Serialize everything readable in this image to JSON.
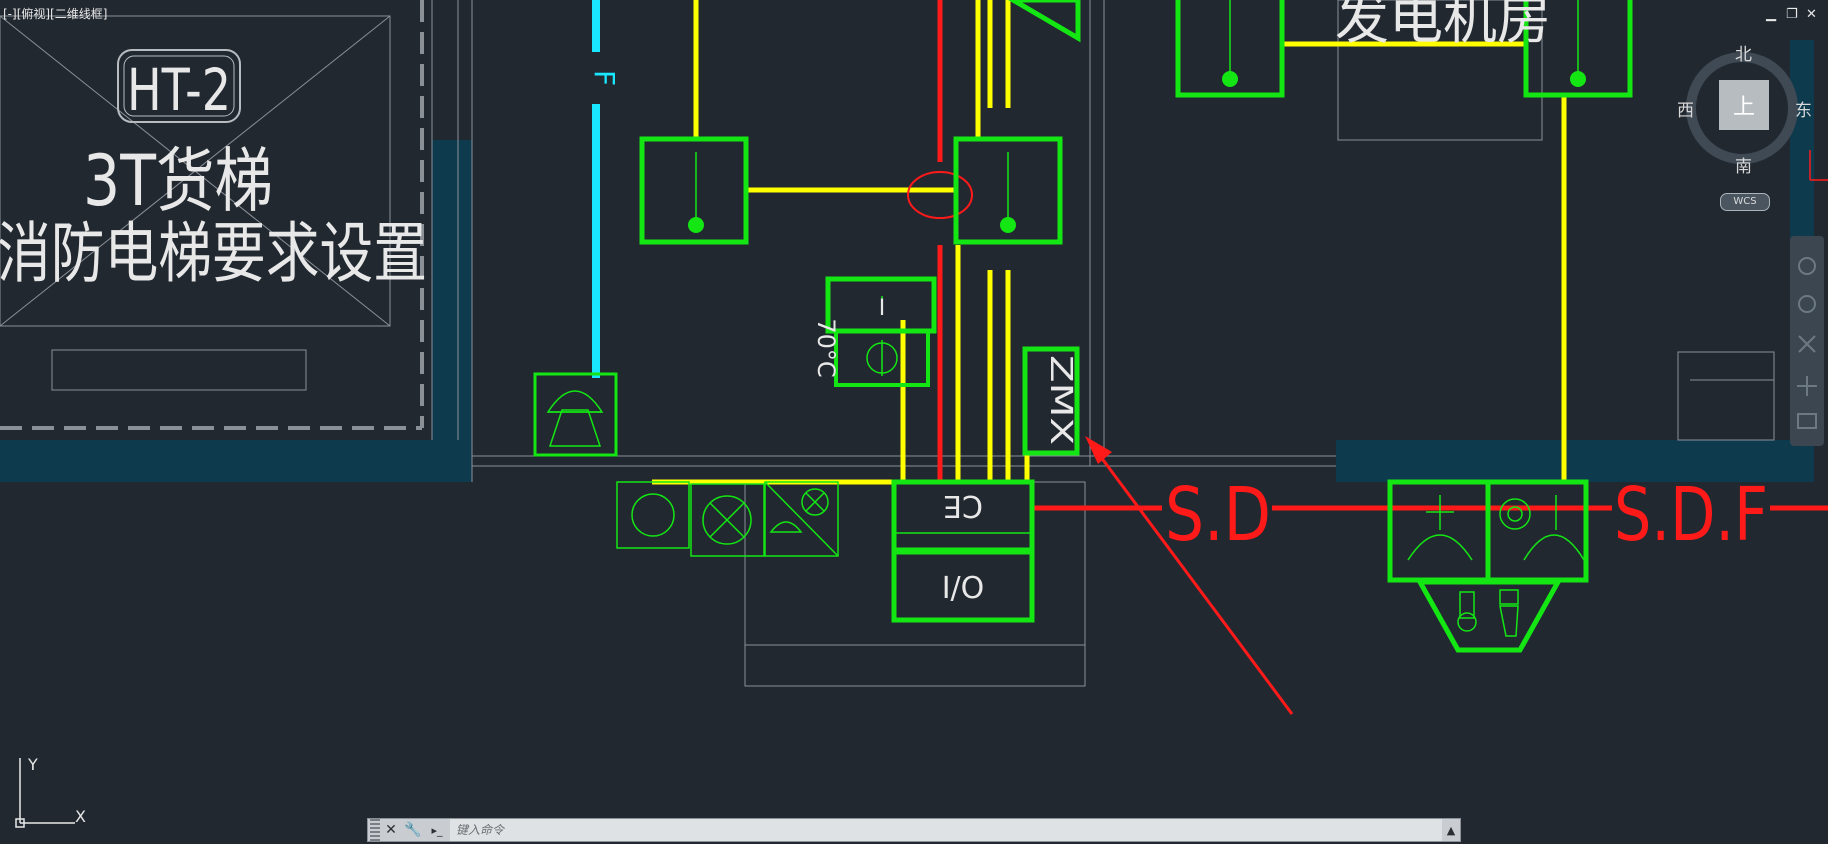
{
  "viewport": {
    "label": "[-][俯视][二维线框]"
  },
  "window_controls": {
    "minimize": "▁",
    "restore": "❐",
    "close": "✕"
  },
  "drawing": {
    "elevator_tag": "HT-2",
    "elevator_name": "3T货梯",
    "elevator_note": "消防电梯要求设置",
    "room_label": "发电机房",
    "temp_label": "70°C",
    "box_i_label": "I",
    "box_zmx_label": "ZMX",
    "box_ce_label": "CE",
    "box_io_label": "I/O",
    "sd_label": "S.D",
    "sdf_label": "S.D.F",
    "f_label": "F"
  },
  "colors": {
    "background": "#212830",
    "green": "#14e614",
    "yellow": "#ffff00",
    "red": "#ff1a1a",
    "cyan": "#19e6ff",
    "wall": "#0e3a4e",
    "gray_line": "#8a9096"
  },
  "viewcube": {
    "north": "北",
    "south": "南",
    "east": "东",
    "west": "西",
    "face": "上",
    "wcs": "WCS"
  },
  "ucs": {
    "x": "X",
    "y": "Y"
  },
  "command_line": {
    "close_icon": "✕",
    "settings_icon": "🔧",
    "prompt_icon": "▸_",
    "placeholder": "键入命令",
    "expand_icon": "▲"
  }
}
